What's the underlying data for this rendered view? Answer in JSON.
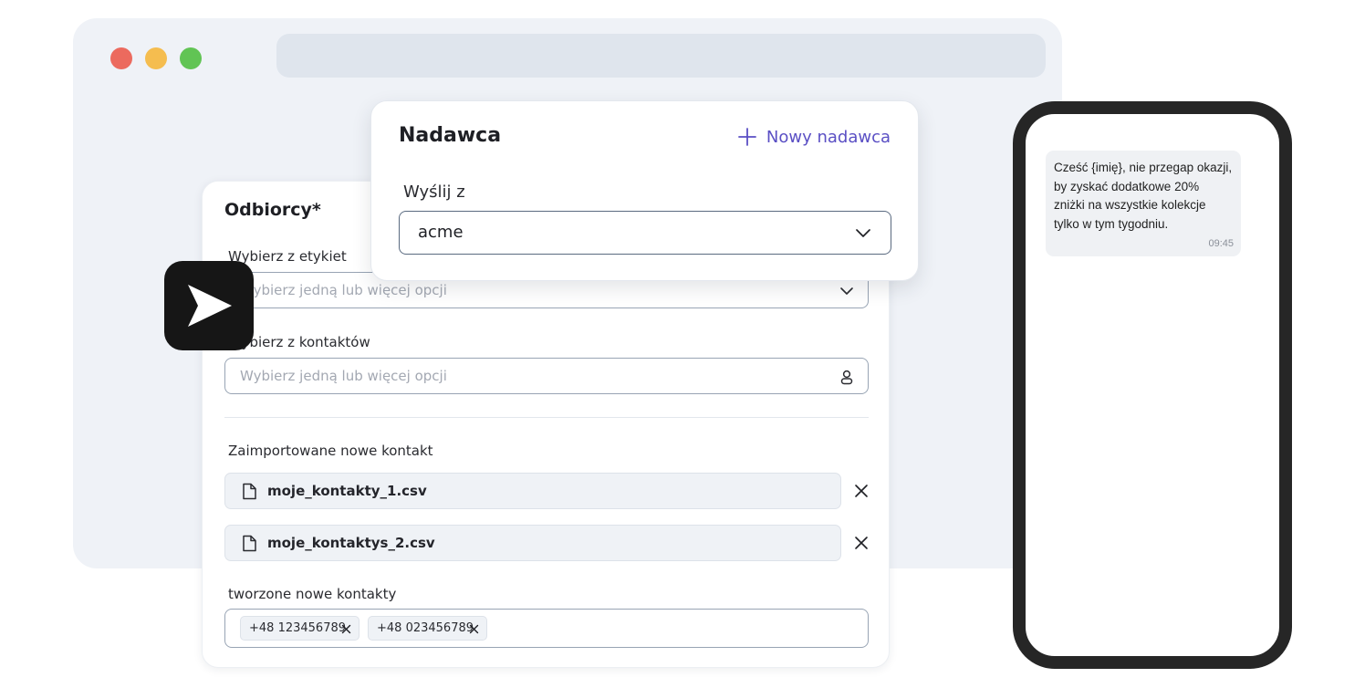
{
  "window": {
    "url": ""
  },
  "recipients": {
    "title": "Odbiorcy*",
    "tags_label": "Wybierz z etykiet",
    "tags_placeholder": "Wybierz jedną lub więcej opcji",
    "contacts_label": "Wybierz z kontaktów",
    "contacts_placeholder": "Wybierz jedną lub więcej opcji",
    "imported_label": "Zaimportowane nowe kontakt",
    "files": [
      {
        "name": "moje_kontakty_1.csv"
      },
      {
        "name": "moje_kontaktys_2.csv"
      }
    ],
    "created_label": "tworzone nowe kontakty",
    "phones": [
      "+48 123456789",
      "+48 023456789"
    ]
  },
  "sender": {
    "title": "Nadawca",
    "new_sender_label": "Nowy nadawca",
    "send_from_label": "Wyślij z",
    "selected": "acme"
  },
  "phone_preview": {
    "message": "Cześć {imię}, nie przegap okazji, by zyskać dodatkowe 20% zniżki na wszystkie kolekcje tylko w tym tygodniu.",
    "time": "09:45"
  },
  "colors": {
    "accent": "#5a4fc4",
    "window_bg": "#eff2f7",
    "urlbar": "#dfe5ed",
    "dot_red": "#ec6a5e",
    "dot_yellow": "#f5bd4f",
    "dot_green": "#61c454",
    "logo_bg": "#161616",
    "phone_frame": "#262626"
  }
}
